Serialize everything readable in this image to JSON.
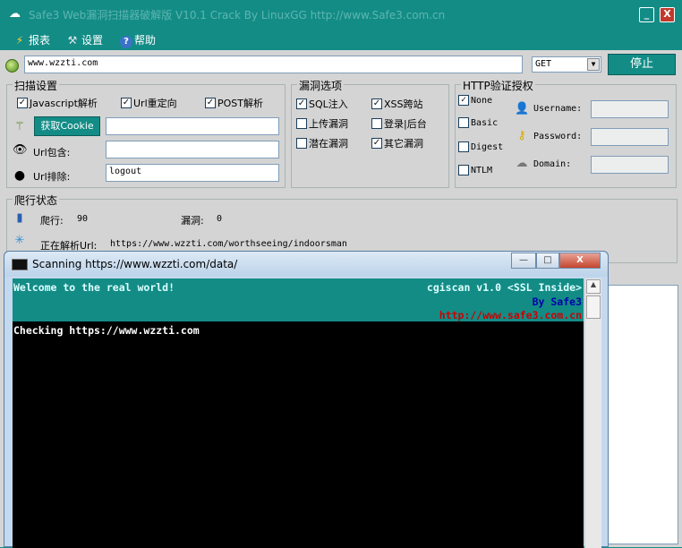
{
  "app": {
    "title": "Safe3 Web漏洞扫描器破解版 V10.1  Crack By LinuxGG  http://www.Safe3.com.cn",
    "minimize": "_",
    "close": "X"
  },
  "menu": [
    {
      "label": "报表",
      "icon": "lightning-icon"
    },
    {
      "label": "设置",
      "icon": "tools-icon"
    },
    {
      "label": "帮助",
      "icon": "help-icon"
    }
  ],
  "url_bar": {
    "value": "www.wzzti.com",
    "method": "GET",
    "stop_label": "停止"
  },
  "scan_settings": {
    "title": "扫描设置",
    "options": [
      {
        "label": "Javascript解析",
        "checked": true
      },
      {
        "label": "Url重定向",
        "checked": true
      },
      {
        "label": "POST解析",
        "checked": true
      }
    ],
    "get_cookie_label": "获取Cookie",
    "cookie_value": "",
    "url_include_label": "Url包含:",
    "url_include_value": "",
    "url_exclude_label": "Url排除:",
    "url_exclude_value": "logout"
  },
  "vuln_options": {
    "title": "漏洞选项",
    "items": [
      {
        "label": "SQL注入",
        "checked": true
      },
      {
        "label": "XSS跨站",
        "checked": true
      },
      {
        "label": "上传漏洞",
        "checked": false
      },
      {
        "label": "登录|后台",
        "checked": false
      },
      {
        "label": "潜在漏洞",
        "checked": false
      },
      {
        "label": "其它漏洞",
        "checked": true
      }
    ]
  },
  "http_auth": {
    "title": "HTTP验证授权",
    "types": [
      {
        "label": "None",
        "checked": true
      },
      {
        "label": "Basic",
        "checked": false
      },
      {
        "label": "Digest",
        "checked": false
      },
      {
        "label": "NTLM",
        "checked": false
      }
    ],
    "username_label": "Username:",
    "password_label": "Password:",
    "domain_label": "Domain:",
    "username_value": "",
    "password_value": "",
    "domain_value": ""
  },
  "status": {
    "title": "爬行状态",
    "crawl_label": "爬行:",
    "crawl_count": "90",
    "vuln_label": "漏洞:",
    "vuln_count": "0",
    "parsing_label": "正在解析Url:",
    "parsing_url": "https://www.wzzti.com/worthseeing/indoorsman"
  },
  "console": {
    "title": "Scanning https://www.wzzti.com/data/",
    "welcome": "Welcome to the real world!",
    "product": "cgiscan v1.0  <SSL Inside>",
    "by": "By Safe3",
    "url": "http://www.safe3.com.cn",
    "line1": "Checking https://www.wzzti.com",
    "min": "—",
    "max": "□",
    "close": "X"
  },
  "colors": {
    "accent": "#138c86",
    "panel": "#d4d4d4",
    "console_bg": "#000000",
    "banner_url": "#cc0000",
    "banner_by": "#0000aa"
  }
}
